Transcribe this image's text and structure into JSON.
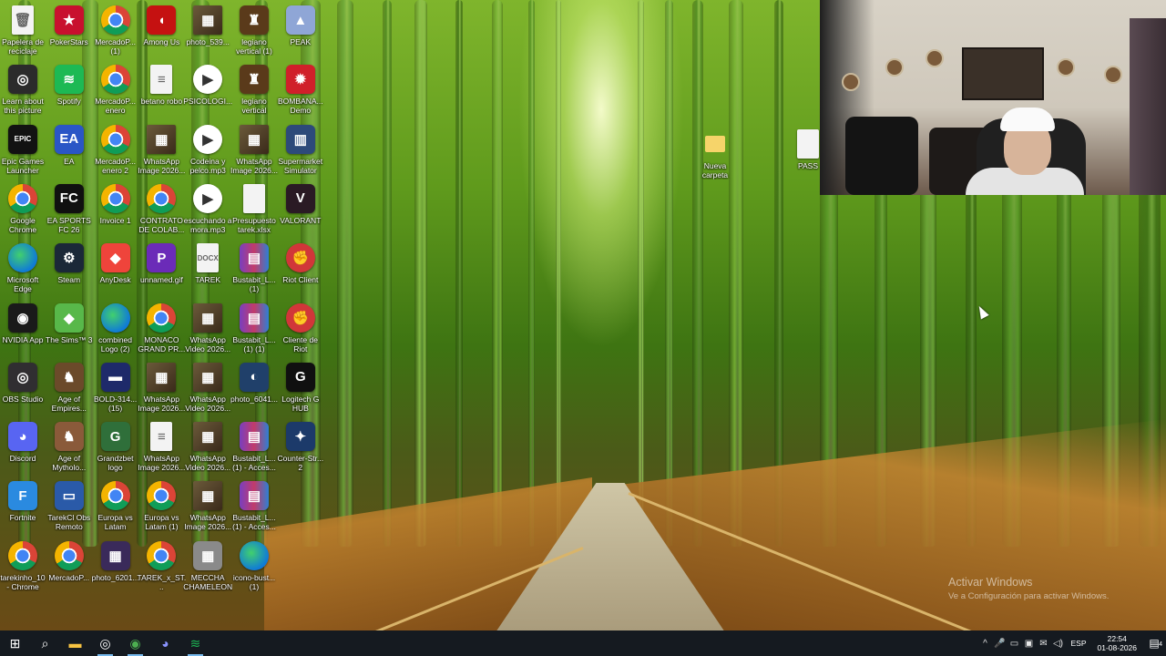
{
  "desktop": {
    "icons": [
      {
        "label": "Papelera de reciclaje",
        "icon": "recycle-bin-icon",
        "glyph": "🗑",
        "style": "g-file"
      },
      {
        "label": "PokerStars",
        "icon": "pokerstars-icon",
        "glyph": "★",
        "color": "#c8102e"
      },
      {
        "label": "MercadoP... (1)",
        "icon": "chrome-shortcut-icon",
        "glyph": "",
        "style": "g-chrome"
      },
      {
        "label": "Among Us",
        "icon": "among-us-icon",
        "glyph": "◖",
        "color": "#c51111"
      },
      {
        "label": "photo_539...",
        "icon": "image-file-icon",
        "glyph": "▦",
        "style": "g-photo"
      },
      {
        "label": "legiano vertical (1)",
        "icon": "image-file-icon",
        "glyph": "♜",
        "color": "#5a3a1a"
      },
      {
        "label": "PEAK",
        "icon": "peak-icon",
        "glyph": "▲",
        "color": "#8fa6d6"
      },
      {
        "label": "Learn about this picture",
        "icon": "learn-picture-icon",
        "glyph": "◎",
        "color": "#2b2b2b"
      },
      {
        "label": "Spotify",
        "icon": "spotify-icon",
        "glyph": "≋",
        "color": "#1db954"
      },
      {
        "label": "MercadoP... enero",
        "icon": "chrome-shortcut-icon",
        "glyph": "",
        "style": "g-chrome"
      },
      {
        "label": "betano robo",
        "icon": "text-file-icon",
        "glyph": "≡",
        "style": "g-file"
      },
      {
        "label": "PSICOLOGI...",
        "icon": "video-file-icon",
        "glyph": "▶",
        "style": "g-video"
      },
      {
        "label": "legiano vertical",
        "icon": "image-file-icon",
        "glyph": "♜",
        "color": "#5a3a1a"
      },
      {
        "label": "BOMBANA... Demo",
        "icon": "bombana-icon",
        "glyph": "✹",
        "color": "#d0202a"
      },
      {
        "label": "Epic Games Launcher",
        "icon": "epic-games-icon",
        "glyph": "EPIC",
        "color": "#121212"
      },
      {
        "label": "EA",
        "icon": "ea-icon",
        "glyph": "EA",
        "color": "#2a56c6"
      },
      {
        "label": "MercadoP... enero 2",
        "icon": "chrome-shortcut-icon",
        "glyph": "",
        "style": "g-chrome"
      },
      {
        "label": "WhatsApp Image 2026...",
        "icon": "image-file-icon",
        "glyph": "▦",
        "style": "g-photo"
      },
      {
        "label": "Codeina y pelco.mp3",
        "icon": "audio-file-icon",
        "glyph": "▶",
        "style": "g-video"
      },
      {
        "label": "WhatsApp Image 2026...",
        "icon": "image-file-icon",
        "glyph": "▦",
        "style": "g-photo"
      },
      {
        "label": "Supermarket Simulator",
        "icon": "supermarket-simulator-icon",
        "glyph": "▥",
        "color": "#2d4a7a"
      },
      {
        "label": "Google Chrome",
        "icon": "chrome-icon",
        "glyph": "",
        "style": "g-chrome"
      },
      {
        "label": "EA SPORTS FC 26",
        "icon": "ea-fc-icon",
        "glyph": "FC",
        "color": "#101010"
      },
      {
        "label": "Invoice 1",
        "icon": "chrome-shortcut-icon",
        "glyph": "",
        "style": "g-chrome"
      },
      {
        "label": "CONTRATO DE COLAB...",
        "icon": "chrome-shortcut-icon",
        "glyph": "",
        "style": "g-chrome"
      },
      {
        "label": "escuchando a mora.mp3",
        "icon": "audio-file-icon",
        "glyph": "▶",
        "style": "g-video"
      },
      {
        "label": "Presupuesto tarek.xlsx",
        "icon": "text-file-icon",
        "glyph": "",
        "style": "g-file"
      },
      {
        "label": "VALORANT",
        "icon": "valorant-icon",
        "glyph": "V",
        "color": "#2a1a24"
      },
      {
        "label": "Microsoft Edge",
        "icon": "edge-icon",
        "glyph": "",
        "style": "g-edge"
      },
      {
        "label": "Steam",
        "icon": "steam-icon",
        "glyph": "⚙",
        "color": "#1b2838"
      },
      {
        "label": "AnyDesk",
        "icon": "anydesk-icon",
        "glyph": "◆",
        "color": "#ef443b"
      },
      {
        "label": "unnamed.gif",
        "icon": "gif-file-icon",
        "glyph": "P",
        "color": "#6b2bb8"
      },
      {
        "label": "TAREK",
        "icon": "docx-file-icon",
        "glyph": "DOCX",
        "style": "g-file"
      },
      {
        "label": "Bustabit_L... (1)",
        "icon": "winrar-icon",
        "glyph": "▤",
        "style": "g-winrar"
      },
      {
        "label": "Riot Client",
        "icon": "riot-client-icon",
        "glyph": "✊",
        "style": "g-riot"
      },
      {
        "label": "NVIDIA App",
        "icon": "nvidia-icon",
        "glyph": "◉",
        "color": "#1a1a1a"
      },
      {
        "label": "The Sims™ 3",
        "icon": "sims-icon",
        "glyph": "◆",
        "color": "#58b84a"
      },
      {
        "label": "combined Logo (2)",
        "icon": "edge-icon",
        "glyph": "",
        "style": "g-edge"
      },
      {
        "label": "MONACO GRAND PR...",
        "icon": "chrome-shortcut-icon",
        "glyph": "",
        "style": "g-chrome"
      },
      {
        "label": "WhatsApp Video 2026...",
        "icon": "video-file-icon",
        "glyph": "▦",
        "style": "g-photo"
      },
      {
        "label": "Bustabit_L... (1) (1)",
        "icon": "winrar-icon",
        "glyph": "▤",
        "style": "g-winrar"
      },
      {
        "label": "Cliente de Riot",
        "icon": "riot-client-icon",
        "glyph": "✊",
        "style": "g-riot"
      },
      {
        "label": "OBS Studio",
        "icon": "obs-icon",
        "glyph": "◎",
        "color": "#302e31"
      },
      {
        "label": "Age of Empires...",
        "icon": "age-of-empires-icon",
        "glyph": "♞",
        "color": "#6b4a2a"
      },
      {
        "label": "BOLD-314... (15)",
        "icon": "image-file-icon",
        "glyph": "▬",
        "color": "#1e2a6a"
      },
      {
        "label": "WhatsApp Image 2026...",
        "icon": "image-file-icon",
        "glyph": "▦",
        "style": "g-photo"
      },
      {
        "label": "WhatsApp Video 2026...",
        "icon": "video-file-icon",
        "glyph": "▦",
        "style": "g-photo"
      },
      {
        "label": "photo_6041...",
        "icon": "image-file-icon",
        "glyph": "◐",
        "color": "#20406a"
      },
      {
        "label": "Logitech G HUB",
        "icon": "logitech-icon",
        "glyph": "G",
        "color": "#101010"
      },
      {
        "label": "Discord",
        "icon": "discord-icon",
        "glyph": "◕",
        "color": "#5865f2"
      },
      {
        "label": "Age of Mytholo...",
        "icon": "age-of-mythology-icon",
        "glyph": "♞",
        "color": "#8a5a3a"
      },
      {
        "label": "Grandzbet logo",
        "icon": "image-file-icon",
        "glyph": "G",
        "color": "#2f6f3a"
      },
      {
        "label": "WhatsApp Image 2026...",
        "icon": "image-file-icon",
        "glyph": "≡",
        "style": "g-file"
      },
      {
        "label": "WhatsApp Video 2026...",
        "icon": "video-file-icon",
        "glyph": "▦",
        "style": "g-photo"
      },
      {
        "label": "Bustabit_L... (1) - Acces...",
        "icon": "winrar-icon",
        "glyph": "▤",
        "style": "g-winrar"
      },
      {
        "label": "Counter-Str... 2",
        "icon": "counter-strike-icon",
        "glyph": "✦",
        "color": "#1c3a6a"
      },
      {
        "label": "Fortnite",
        "icon": "fortnite-icon",
        "glyph": "F",
        "color": "#2a8ae0"
      },
      {
        "label": "TarekCl Obs Remoto",
        "icon": "computer-shortcut-icon",
        "glyph": "▭",
        "color": "#2a5aa8"
      },
      {
        "label": "Europa vs Latam",
        "icon": "chrome-shortcut-icon",
        "glyph": "",
        "style": "g-chrome"
      },
      {
        "label": "Europa vs Latam (1)",
        "icon": "chrome-shortcut-icon",
        "glyph": "",
        "style": "g-chrome"
      },
      {
        "label": "WhatsApp Image 2026...",
        "icon": "image-file-icon",
        "glyph": "▦",
        "style": "g-photo"
      },
      {
        "label": "Bustabit_L... (1) - Acces...",
        "icon": "winrar-icon",
        "glyph": "▤",
        "style": "g-winrar"
      },
      {
        "label": "",
        "icon": "empty-slot",
        "glyph": "",
        "hidden": true
      },
      {
        "label": "tarekinho_10 - Chrome",
        "icon": "chrome-icon",
        "glyph": "",
        "style": "g-chrome"
      },
      {
        "label": "MercadoP...",
        "icon": "chrome-shortcut-icon",
        "glyph": "",
        "style": "g-chrome"
      },
      {
        "label": "photo_6201...",
        "icon": "image-file-icon",
        "glyph": "▦",
        "color": "#3a2a5a"
      },
      {
        "label": "TAREK_x_ST...",
        "icon": "chrome-shortcut-icon",
        "glyph": "",
        "style": "g-chrome"
      },
      {
        "label": "MECCHA CHAMELEON",
        "icon": "meccha-chameleon-icon",
        "glyph": "▦",
        "color": "#8a8a8a"
      },
      {
        "label": "icono-bust... (1)",
        "icon": "edge-icon",
        "glyph": "",
        "style": "g-edge"
      },
      {
        "label": "",
        "icon": "empty-slot",
        "glyph": "",
        "hidden": true
      }
    ],
    "right_items": [
      {
        "label": "Nueva carpeta",
        "icon": "folder-icon"
      },
      {
        "label": "PASS",
        "icon": "text-file-icon"
      }
    ]
  },
  "watermark": {
    "line1": "Activar Windows",
    "line2": "Ve a Configuración para activar Windows."
  },
  "taskbar": {
    "start_glyph": "⊞",
    "search_glyph": "⌕",
    "apps": [
      {
        "name": "file-explorer-icon",
        "glyph": "▬",
        "color": "#f6c342",
        "active": false
      },
      {
        "name": "obs-taskbar-icon",
        "glyph": "◎",
        "color": "#ffffff",
        "active": true
      },
      {
        "name": "chrome-taskbar-icon",
        "glyph": "◉",
        "color": "#4caf50",
        "active": true
      },
      {
        "name": "discord-taskbar-icon",
        "glyph": "◕",
        "color": "#8a94ff",
        "active": false
      },
      {
        "name": "spotify-taskbar-icon",
        "glyph": "≋",
        "color": "#1db954",
        "active": true
      }
    ],
    "tray": {
      "chevron": "^",
      "mic": "🎤",
      "icons": [
        "▭",
        "▣",
        "✉",
        "◁)",
        "⌂"
      ],
      "language": "ESP",
      "time": "22:54",
      "date": "01-08-2026",
      "notifications_glyph": "▤",
      "notifications_count": "4"
    }
  }
}
